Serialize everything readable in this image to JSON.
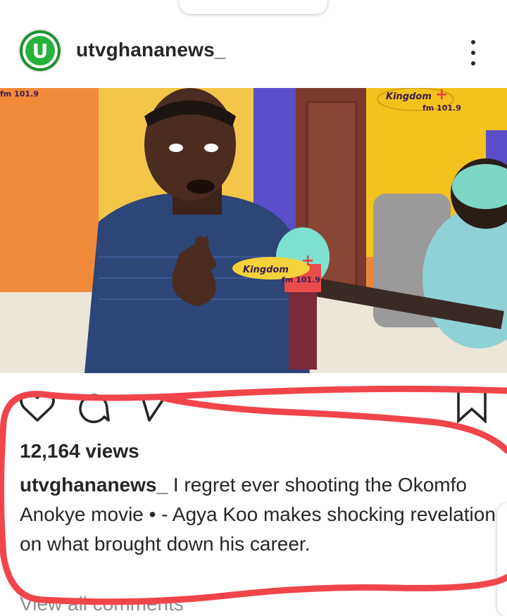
{
  "post": {
    "username": "utvghananews_",
    "avatar_text": "U",
    "views": "12,164 views",
    "caption_user": "utvghananews_",
    "caption_text": " I regret ever shooting the Okomfo Anokye movie • - Agya Koo makes shocking revelation on what brought down his career.",
    "view_all_comments": "View all comments"
  },
  "media": {
    "logo_top_left": "fm 101.9",
    "logo_brand": "Kingdom",
    "logo_freq": "fm 101.9"
  },
  "icons": {
    "like": "heart-outline-icon",
    "comment": "comment-bubble-icon",
    "share": "paper-plane-icon",
    "save": "bookmark-icon",
    "more": "vertical-dots-icon"
  },
  "colors": {
    "annotation": "#f0454a",
    "text": "#262626",
    "muted": "#8e8e8e",
    "brand_green": "#27b23b"
  }
}
